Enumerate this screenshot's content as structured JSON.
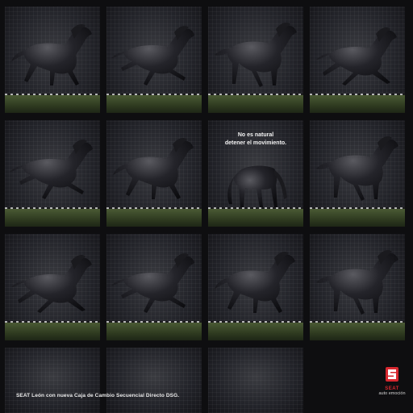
{
  "panel_text": {
    "line1": "No es natural",
    "line2": "detener el movimiento."
  },
  "footer": {
    "tagline": "SEAT León con nueva Caja de Cambio Secuencial Directo DSG."
  },
  "brand": {
    "name": "SEAT",
    "slogan": "auto emoción",
    "color": "#d7282f"
  },
  "horse_frames": [
    {
      "pose": "gallop"
    },
    {
      "pose": "gallop"
    },
    {
      "pose": "gallop"
    },
    {
      "pose": "gallop"
    },
    {
      "pose": "gallop"
    },
    {
      "pose": "gallop"
    },
    {
      "pose": "standing-rear-view"
    },
    {
      "pose": "gallop"
    },
    {
      "pose": "gallop"
    },
    {
      "pose": "gallop"
    },
    {
      "pose": "gallop"
    },
    {
      "pose": "gallop"
    }
  ]
}
